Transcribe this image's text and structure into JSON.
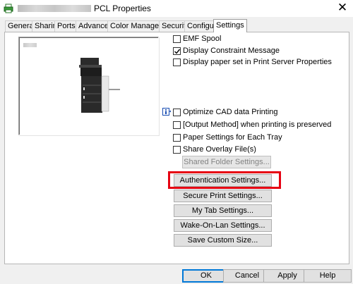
{
  "window": {
    "title": "PCL Properties",
    "close_glyph": "✕"
  },
  "tabs": [
    {
      "label": "General"
    },
    {
      "label": "Sharing"
    },
    {
      "label": "Ports"
    },
    {
      "label": "Advanced"
    },
    {
      "label": "Color Management"
    },
    {
      "label": "Security"
    },
    {
      "label": "Configure"
    },
    {
      "label": "Settings",
      "active": true
    }
  ],
  "options_top": [
    {
      "label": "EMF Spool",
      "checked": false
    },
    {
      "label": "Display Constraint Message",
      "checked": true
    },
    {
      "label": "Display paper set in Print Server Properties",
      "checked": false
    }
  ],
  "options_bottom": [
    {
      "label": "Optimize CAD data Printing",
      "checked": false
    },
    {
      "label": "[Output Method] when printing is preserved",
      "checked": false
    },
    {
      "label": "Paper Settings for Each Tray",
      "checked": false
    },
    {
      "label": "Share Overlay File(s)",
      "checked": false
    }
  ],
  "buttons": {
    "shared_folder": "Shared Folder Settings...",
    "authentication": "Authentication Settings...",
    "secure_print": "Secure Print Settings...",
    "my_tab": "My Tab Settings...",
    "wake_on_lan": "Wake-On-Lan Settings...",
    "save_custom": "Save Custom Size..."
  },
  "footer": {
    "ok": "OK",
    "cancel": "Cancel",
    "apply": "Apply",
    "help": "Help"
  },
  "colors": {
    "highlight": "#e60012",
    "check": "#000000",
    "accent": "#0078d7"
  }
}
